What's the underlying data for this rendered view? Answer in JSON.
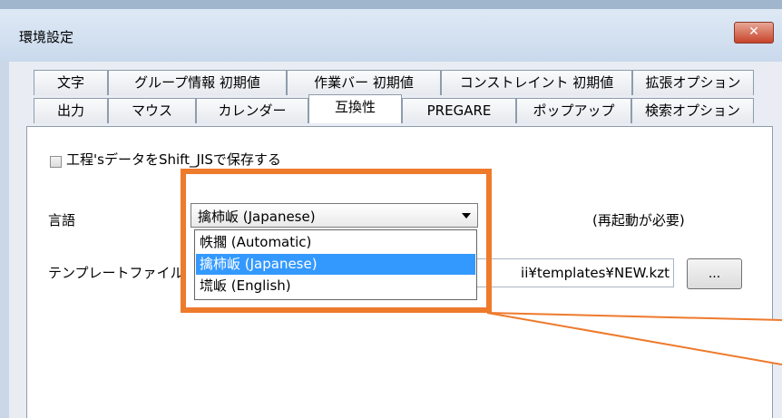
{
  "window": {
    "title": "環境設定",
    "close_label": "✕"
  },
  "tabs_row1": [
    {
      "label": "文字"
    },
    {
      "label": "グループ情報 初期値"
    },
    {
      "label": "作業バー 初期値"
    },
    {
      "label": "コンストレイント 初期値"
    },
    {
      "label": "拡張オプション"
    }
  ],
  "tabs_row2": [
    {
      "label": "出力"
    },
    {
      "label": "マウス"
    },
    {
      "label": "カレンダー"
    },
    {
      "label": "互換性",
      "selected": true
    },
    {
      "label": "PREGARE"
    },
    {
      "label": "ポップアップ"
    },
    {
      "label": "検索オプション"
    }
  ],
  "options": {
    "shiftjis_checkbox_label": "工程'sデータをShift_JISで保存する",
    "shiftjis_checked": false,
    "language_label": "言語",
    "language_selected": "擒柿岅 (Japanese)",
    "language_options": [
      {
        "label": "帙擱 (Automatic)"
      },
      {
        "label": "擒柿岅 (Japanese)"
      },
      {
        "label": "塃岅 (English)"
      }
    ],
    "restart_note": "(再起動が必要)",
    "template_label": "テンプレートファイル",
    "template_path": "ii¥templates¥NEW.kzt",
    "browse_label": "..."
  },
  "colors": {
    "highlight": "#ee7a2c",
    "selection": "#3399ff"
  }
}
